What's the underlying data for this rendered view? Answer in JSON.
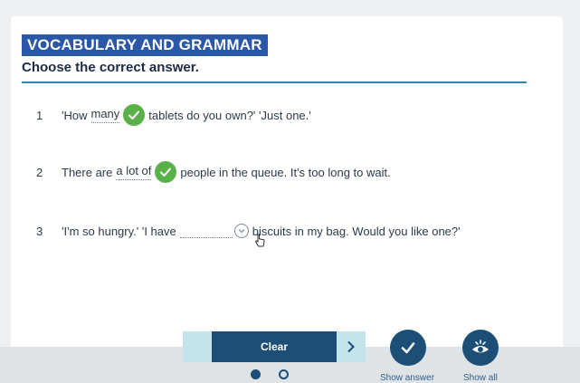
{
  "section": {
    "title": "VOCABULARY AND GRAMMAR",
    "instruction": "Choose the correct answer."
  },
  "questions": [
    {
      "num": "1",
      "before": "'How",
      "answer": "many",
      "after": "tablets do you own?' 'Just one.'",
      "status": "correct"
    },
    {
      "num": "2",
      "before": "There are",
      "answer": "a lot of",
      "after": "people in the queue. It's too long to wait.",
      "status": "correct"
    },
    {
      "num": "3",
      "before": "'I'm so hungry.' 'I have",
      "answer": "",
      "after": "biscuits in my bag. Would you like one?'",
      "status": "unanswered"
    }
  ],
  "toolbar": {
    "clear_label": "Clear",
    "show_answer_label": "Show answer",
    "show_all_label": "Show all"
  },
  "pagination": {
    "current_page": 1,
    "total_pages": 2
  },
  "colors": {
    "title_bg": "#2a57a8",
    "rule": "#2b86b0",
    "correct": "#5ab14a",
    "primary": "#1d4e78",
    "secondary": "#c2e4ea"
  }
}
